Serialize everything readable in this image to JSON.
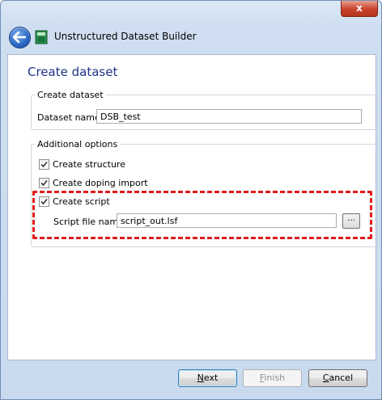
{
  "window": {
    "title": "Unstructured Dataset Builder",
    "close_glyph": "x"
  },
  "page": {
    "title": "Create dataset"
  },
  "create_group": {
    "legend": "Create dataset",
    "dataset_name_label": "Dataset name",
    "dataset_name_value": "DSB_test"
  },
  "options_group": {
    "legend": "Additional options",
    "create_structure": {
      "label": "Create structure",
      "checked": true
    },
    "create_doping_import": {
      "label": "Create doping import",
      "checked": true
    },
    "create_script": {
      "label": "Create script",
      "checked": true
    },
    "script_file_label": "Script file name",
    "script_file_value": "script_out.lsf",
    "browse_label": "..."
  },
  "buttons": {
    "next": "Next",
    "finish": "Finish",
    "cancel": "Cancel"
  },
  "colors": {
    "accent_title": "#1e3287",
    "highlight_border": "#e01b1b"
  }
}
